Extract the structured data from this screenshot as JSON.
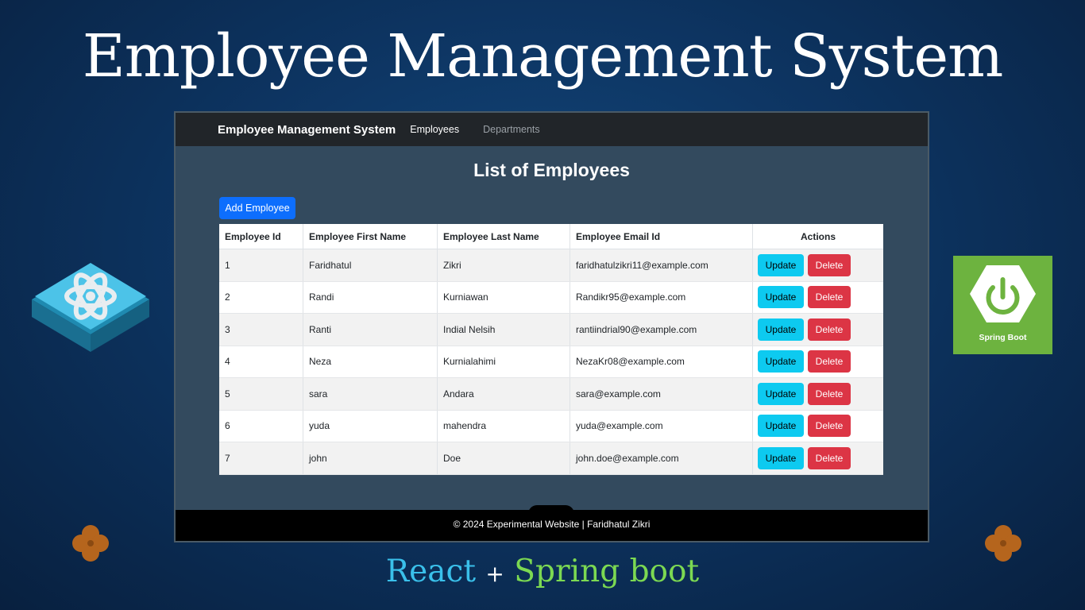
{
  "headline": "Employee Management System",
  "app": {
    "navbar": {
      "brand": "Employee Management System",
      "links": [
        "Employees",
        "Departments"
      ]
    },
    "page_title": "List of Employees",
    "add_button": "Add Employee",
    "table": {
      "columns": [
        "Employee Id",
        "Employee First Name",
        "Employee Last Name",
        "Employee Email Id",
        "Actions"
      ],
      "rows": [
        {
          "id": "1",
          "first": "Faridhatul",
          "last": "Zikri",
          "email": "faridhatulzikri11@example.com"
        },
        {
          "id": "2",
          "first": "Randi",
          "last": "Kurniawan",
          "email": "Randikr95@example.com"
        },
        {
          "id": "3",
          "first": "Ranti",
          "last": "Indial Nelsih",
          "email": "rantiindrial90@example.com"
        },
        {
          "id": "4",
          "first": "Neza",
          "last": "Kurnialahimi",
          "email": "NezaKr08@example.com"
        },
        {
          "id": "5",
          "first": "sara",
          "last": "Andara",
          "email": "sara@example.com"
        },
        {
          "id": "6",
          "first": "yuda",
          "last": "mahendra",
          "email": "yuda@example.com"
        },
        {
          "id": "7",
          "first": "john",
          "last": "Doe",
          "email": "john.doe@example.com"
        }
      ],
      "update_label": "Update",
      "delete_label": "Delete"
    },
    "footer": "© 2024 Experimental Website | Faridhatul Zikri"
  },
  "spring_logo_label": "Spring Boot",
  "tagline": {
    "left": "React",
    "plus": "+",
    "right": "Spring boot"
  },
  "colors": {
    "primary": "#0d6efd",
    "info": "#0dcaf0",
    "danger": "#dc3545",
    "spring": "#6db33f",
    "react": "#3ac0ea"
  },
  "icons": [
    "react-logo-icon",
    "spring-power-icon",
    "clover-icon",
    "comment-icon",
    "user-icon",
    "menu-icon"
  ]
}
